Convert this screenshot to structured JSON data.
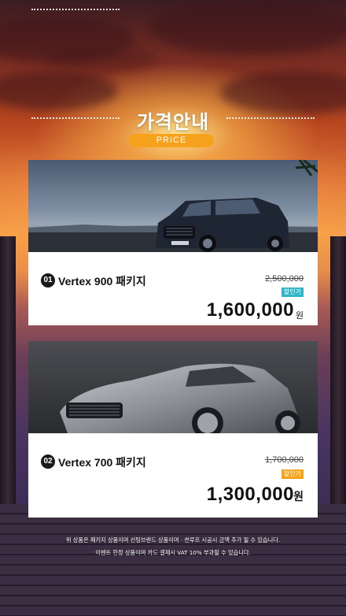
{
  "header": {
    "title": "가격안내",
    "subtitle_pill": "PRICE"
  },
  "packages": [
    {
      "number": "01",
      "name": "Vertex 900 패키지",
      "original_price": "2,500,000",
      "badge": "할인가",
      "badge_color": "#2fb4c8",
      "sale_price": "1,600,000",
      "currency": "원",
      "image": "suv-car-image"
    },
    {
      "number": "02",
      "name": "Vertex 700 패키지",
      "original_price": "1,700,000",
      "badge": "할인가",
      "badge_color": "#f7a21c",
      "sale_price": "1,300,000",
      "currency": "원",
      "image": "sports-car-image"
    }
  ],
  "notes": {
    "line1": "위 상품은 패키지 상품이며 선팅브랜드 상품이며 · 썬루프 시공시 금액 추가 될 수 있습니다.",
    "line2": "이벤트 한정 상품이며 카드 결제시 VAT 10% 부과될 수 있습니다."
  },
  "colors": {
    "accent": "#f7a21c",
    "teal_badge": "#2fb4c8"
  }
}
